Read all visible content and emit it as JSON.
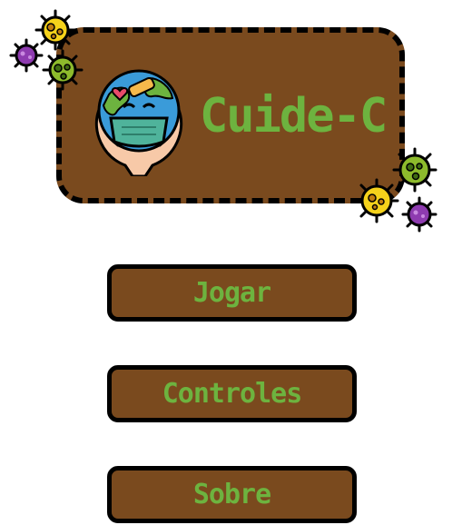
{
  "logo": {
    "title": "Cuide-C",
    "emblem_icon": "earth-with-mask-in-hands-icon"
  },
  "menu": {
    "items": [
      {
        "label": "Jogar"
      },
      {
        "label": "Controles"
      },
      {
        "label": "Sobre"
      }
    ]
  },
  "decorations": {
    "virus_icons": [
      "yellow-virus-icon",
      "purple-virus-icon",
      "green-virus-icon"
    ]
  },
  "colors": {
    "panel_brown": "#7a4a1e",
    "text_green": "#6db33f",
    "outline_black": "#000000",
    "virus_yellow": "#f5d21b",
    "virus_purple": "#8e3bb0",
    "virus_green": "#8dbb2c"
  }
}
